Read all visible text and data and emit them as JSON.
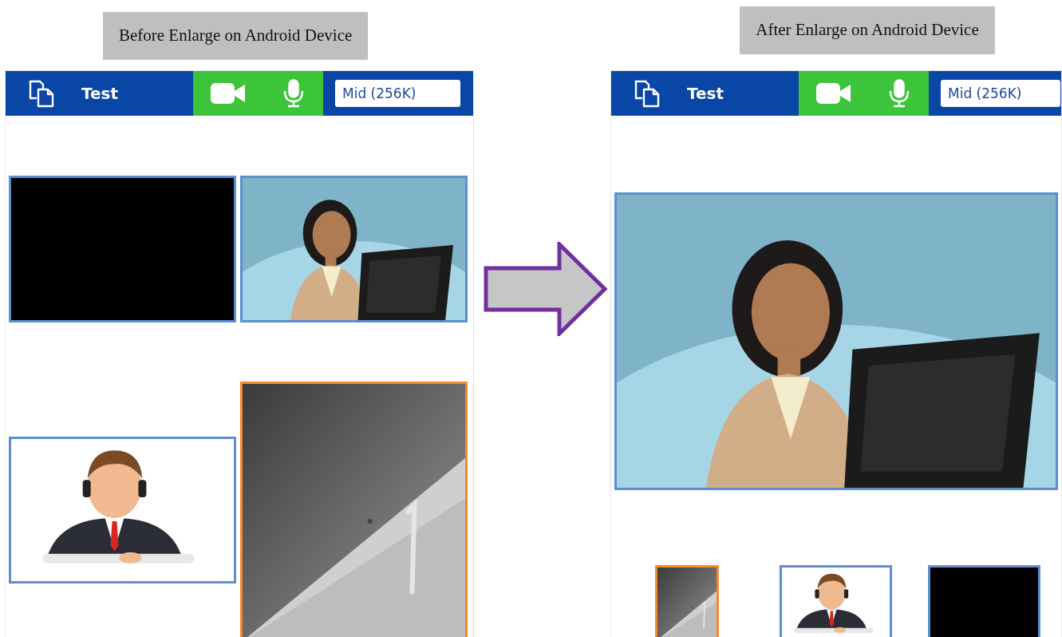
{
  "panels": [
    {
      "caption": "Before Enlarge on Android Device",
      "kind": "grid",
      "header": {
        "title": "Test",
        "camera_on": true,
        "mic_on": true,
        "quality": "Mid (256K)"
      },
      "tiles": [
        {
          "kind": "blank",
          "highlighted": false
        },
        {
          "kind": "picture",
          "highlighted": false
        },
        {
          "kind": "picture",
          "highlighted": false
        },
        {
          "kind": "picture",
          "highlighted": true
        }
      ]
    },
    {
      "caption": "After Enlarge on Android Device",
      "kind": "enlarged",
      "header": {
        "title": "Test",
        "camera_on": true,
        "mic_on": true,
        "quality": "Mid (256K)"
      },
      "tiles": [
        {
          "kind": "picture",
          "highlighted": false
        },
        {
          "kind": "picture",
          "highlighted": true
        },
        {
          "kind": "picture",
          "highlighted": false
        },
        {
          "kind": "blank",
          "highlighted": false
        }
      ]
    }
  ]
}
